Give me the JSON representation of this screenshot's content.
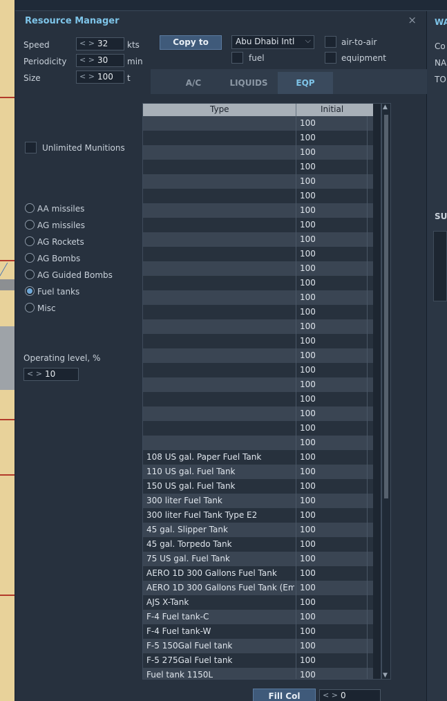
{
  "window": {
    "title": "Resource Manager",
    "close_symbol": "×"
  },
  "params": [
    {
      "label": "Speed",
      "value": "32",
      "unit": "kts"
    },
    {
      "label": "Periodicity",
      "value": "30",
      "unit": "min"
    },
    {
      "label": "Size",
      "value": "100",
      "unit": "t"
    }
  ],
  "copy_button": "Copy to",
  "airport_select": {
    "value": "Abu Dhabi Intl"
  },
  "checkboxes": {
    "air_to_air": "air-to-air",
    "fuel": "fuel",
    "equipment": "equipment"
  },
  "tabs": [
    "A/C",
    "LIQUIDS",
    "EQP"
  ],
  "active_tab": "EQP",
  "unlimited_munitions": "Unlimited Munitions",
  "categories": [
    {
      "label": "AA missiles",
      "selected": false
    },
    {
      "label": "AG missiles",
      "selected": false
    },
    {
      "label": "AG Rockets",
      "selected": false
    },
    {
      "label": "AG Bombs",
      "selected": false
    },
    {
      "label": "AG Guided Bombs",
      "selected": false
    },
    {
      "label": "Fuel tanks",
      "selected": true
    },
    {
      "label": "Misc",
      "selected": false
    }
  ],
  "operating_level": {
    "label": "Operating level, %",
    "value": "10"
  },
  "table": {
    "headers": [
      "Type",
      "Initial"
    ],
    "rows": [
      {
        "type": "",
        "initial": "100"
      },
      {
        "type": "",
        "initial": "100"
      },
      {
        "type": "",
        "initial": "100"
      },
      {
        "type": "",
        "initial": "100"
      },
      {
        "type": "",
        "initial": "100"
      },
      {
        "type": "",
        "initial": "100"
      },
      {
        "type": "",
        "initial": "100"
      },
      {
        "type": "",
        "initial": "100"
      },
      {
        "type": "",
        "initial": "100"
      },
      {
        "type": "",
        "initial": "100"
      },
      {
        "type": "",
        "initial": "100"
      },
      {
        "type": "",
        "initial": "100"
      },
      {
        "type": "",
        "initial": "100"
      },
      {
        "type": "",
        "initial": "100"
      },
      {
        "type": "",
        "initial": "100"
      },
      {
        "type": "",
        "initial": "100"
      },
      {
        "type": "",
        "initial": "100"
      },
      {
        "type": "",
        "initial": "100"
      },
      {
        "type": "",
        "initial": "100"
      },
      {
        "type": "",
        "initial": "100"
      },
      {
        "type": "",
        "initial": "100"
      },
      {
        "type": "",
        "initial": "100"
      },
      {
        "type": "",
        "initial": "100"
      },
      {
        "type": "108 US gal. Paper Fuel Tank",
        "initial": "100"
      },
      {
        "type": "110 US gal. Fuel Tank",
        "initial": "100"
      },
      {
        "type": "150 US gal. Fuel Tank",
        "initial": "100"
      },
      {
        "type": "300 liter Fuel Tank",
        "initial": "100"
      },
      {
        "type": "300 liter Fuel Tank Type E2",
        "initial": "100"
      },
      {
        "type": "45 gal. Slipper Tank",
        "initial": "100"
      },
      {
        "type": "45 gal. Torpedo Tank",
        "initial": "100"
      },
      {
        "type": "75 US gal. Fuel Tank",
        "initial": "100"
      },
      {
        "type": "AERO 1D 300 Gallons Fuel Tank",
        "initial": "100"
      },
      {
        "type": "AERO 1D 300 Gallons Fuel Tank (Emp",
        "initial": "100"
      },
      {
        "type": "AJS X-Tank",
        "initial": "100"
      },
      {
        "type": "F-4 Fuel tank-C",
        "initial": "100"
      },
      {
        "type": "F-4 Fuel tank-W",
        "initial": "100"
      },
      {
        "type": "F-5 150Gal Fuel tank",
        "initial": "100"
      },
      {
        "type": "F-5 275Gal Fuel tank",
        "initial": "100"
      },
      {
        "type": "Fuel tank 1150L",
        "initial": "100"
      }
    ]
  },
  "fill_col": {
    "label": "Fill Col",
    "value": "0"
  },
  "right_panel": {
    "header": "WA",
    "lines": [
      "Co",
      "NA",
      "TO"
    ],
    "sub_header": "SU"
  }
}
